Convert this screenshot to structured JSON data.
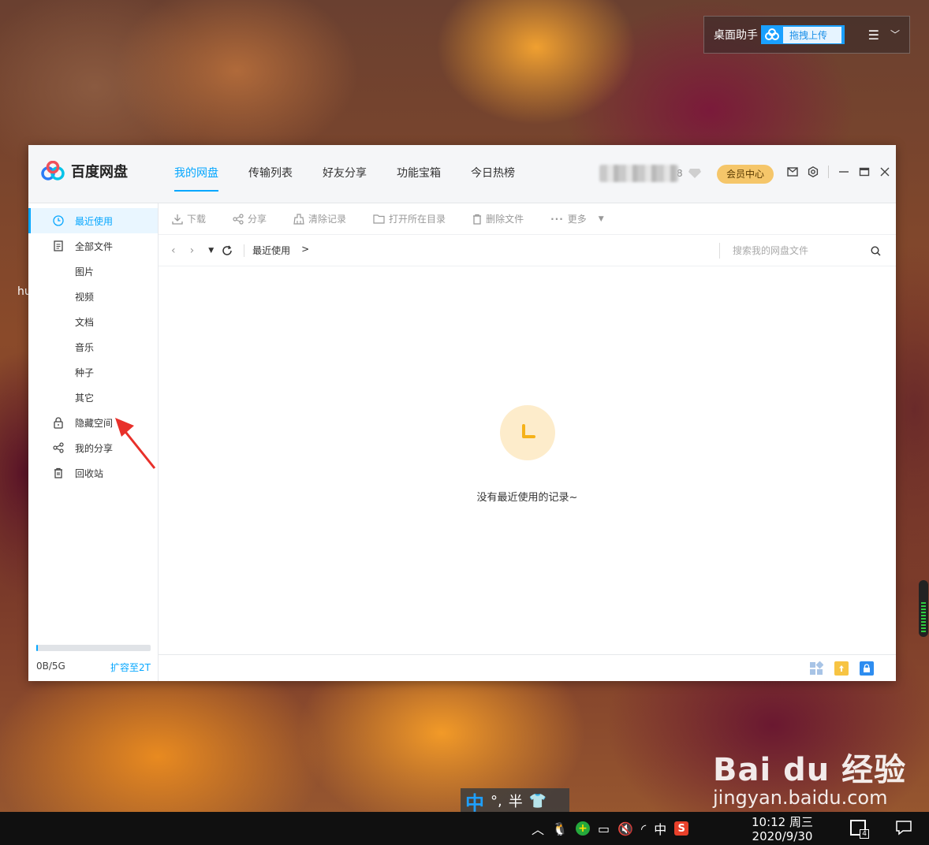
{
  "assistant": {
    "title": "桌面助手",
    "upload_label": "拖拽上传"
  },
  "desktop": {
    "stray_text": "hu"
  },
  "app": {
    "name": "百度网盘",
    "tabs": [
      {
        "label": "我的网盘",
        "active": true
      },
      {
        "label": "传输列表",
        "active": false
      },
      {
        "label": "好友分享",
        "active": false
      },
      {
        "label": "功能宝箱",
        "active": false
      },
      {
        "label": "今日热榜",
        "active": false
      }
    ],
    "user_suffix": "8",
    "vip_label": "会员中心"
  },
  "sidebar": {
    "items": [
      {
        "label": "最近使用",
        "icon": "clock-icon",
        "active": true
      },
      {
        "label": "全部文件",
        "icon": "document-icon"
      },
      {
        "label": "图片",
        "sub": true
      },
      {
        "label": "视频",
        "sub": true
      },
      {
        "label": "文档",
        "sub": true
      },
      {
        "label": "音乐",
        "sub": true
      },
      {
        "label": "种子",
        "sub": true
      },
      {
        "label": "其它",
        "sub": true
      },
      {
        "label": "隐藏空间",
        "icon": "lock-icon"
      },
      {
        "label": "我的分享",
        "icon": "share-icon"
      },
      {
        "label": "回收站",
        "icon": "trash-icon"
      }
    ],
    "quota": {
      "used_label": "0B/5G",
      "expand_label": "扩容至2T",
      "used_fraction": 0.01
    }
  },
  "toolbar": {
    "download": "下载",
    "share": "分享",
    "clear": "清除记录",
    "open_dir": "打开所在目录",
    "delete": "删除文件",
    "more": "更多"
  },
  "address": {
    "crumb": "最近使用",
    "crumb_sep": ">",
    "search_placeholder": "搜索我的网盘文件"
  },
  "empty": {
    "message": "没有最近使用的记录~"
  },
  "ime": {
    "lang": "中",
    "punct": "°,",
    "width": "半"
  },
  "watermark": {
    "line1": "Bai du 经验",
    "line2": "jingyan.baidu.com"
  },
  "taskbar": {
    "ime_lang": "中",
    "time": "10:12 周三",
    "date": "2020/9/30",
    "notification_count": "4"
  },
  "colors": {
    "accent": "#06a7ff",
    "vip": "#f5c66a",
    "empty_icon_bg": "#fdeccb",
    "empty_icon_fg": "#f5b21a"
  }
}
